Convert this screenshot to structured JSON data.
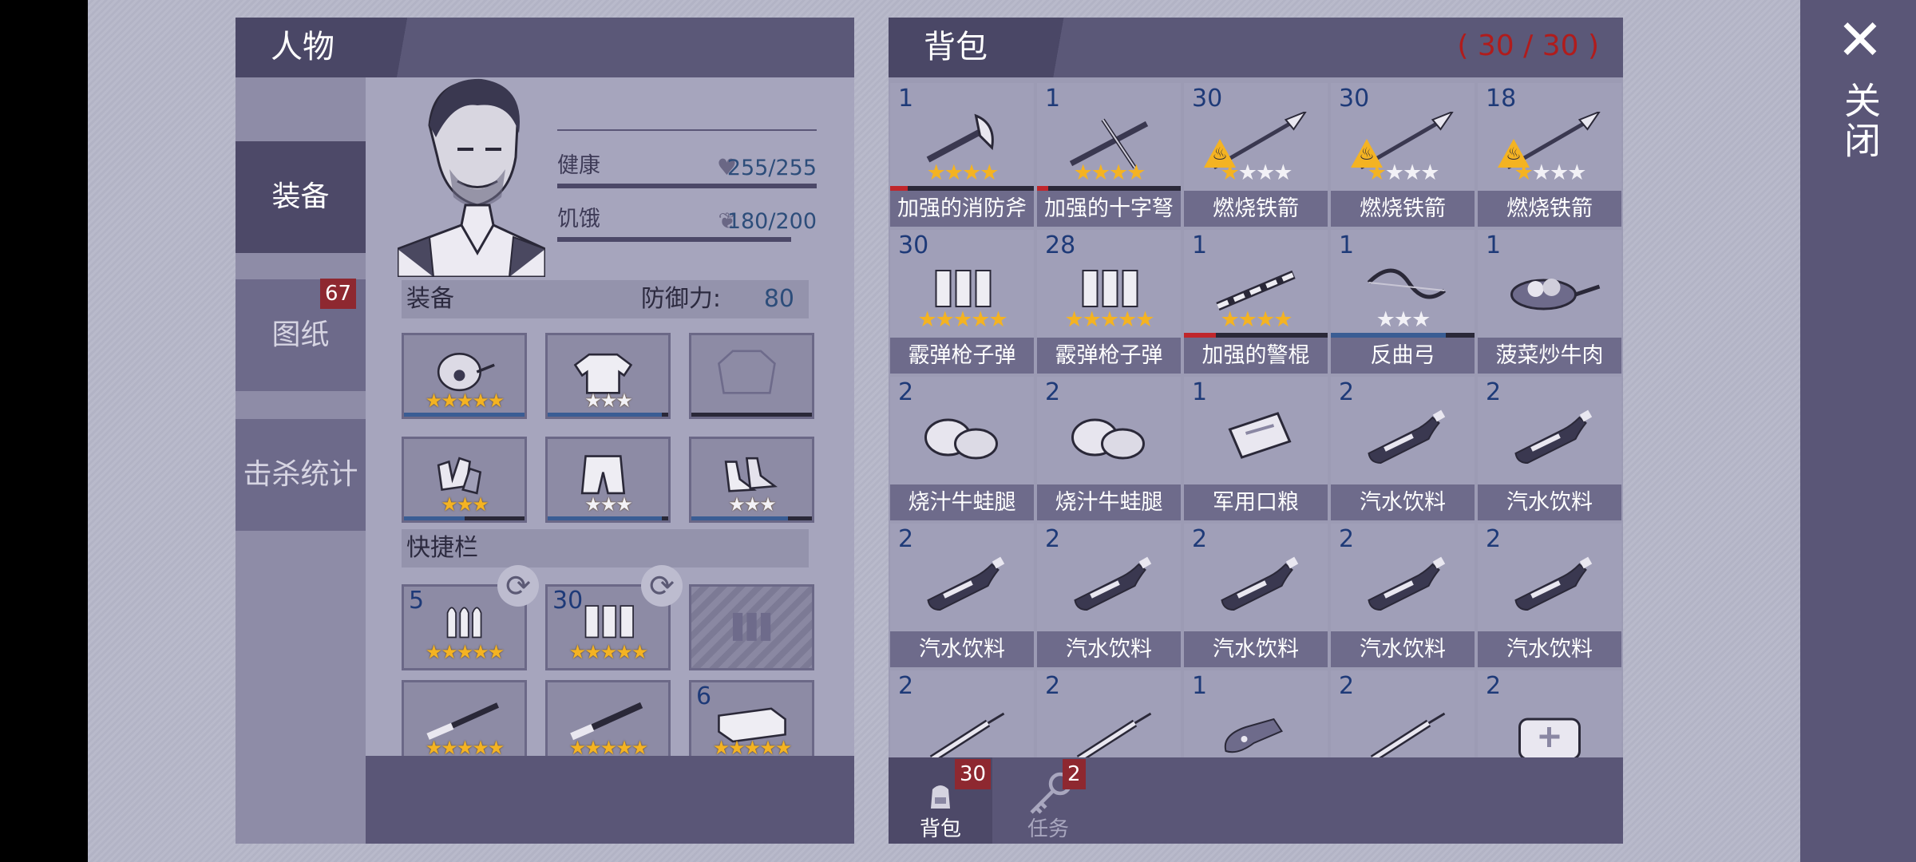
{
  "character": {
    "title": "人物",
    "tabs": [
      {
        "label": "装备",
        "active": true
      },
      {
        "label": "图纸",
        "badge": "67"
      },
      {
        "label": "击杀统计"
      }
    ],
    "stats": {
      "health_label": "健康",
      "health_value": "255/255",
      "health_fraction": 1.0,
      "hunger_label": "饥饿",
      "hunger_value": "180/200",
      "hunger_fraction": 0.9
    },
    "equipment": {
      "label": "装备",
      "defense_label": "防御力:",
      "defense_value": "80",
      "slots": [
        {
          "icon": "gas-mask-icon",
          "stars": 5,
          "filled": 5,
          "durability": 1.0
        },
        {
          "icon": "hoodie-icon",
          "stars": 3,
          "filled": 0,
          "durability": 0.95
        },
        {
          "icon": "jacket-slot-empty-icon",
          "stars": 0,
          "filled": 0,
          "durability": 0
        },
        {
          "icon": "gloves-icon",
          "stars": 3,
          "filled": 3,
          "durability": 0.5
        },
        {
          "icon": "shorts-icon",
          "stars": 3,
          "filled": 0,
          "durability": 0.95
        },
        {
          "icon": "shoes-icon",
          "stars": 3,
          "filled": 0,
          "durability": 0.8
        }
      ]
    },
    "quickbar": {
      "label": "快捷栏",
      "slots": [
        {
          "icon": "bullets-icon",
          "count": "5",
          "stars": 5,
          "filled": 5
        },
        {
          "icon": "shotgun-shells-icon",
          "count": "30",
          "stars": 5,
          "filled": 5
        },
        {
          "icon": "ammo-slot-empty-icon",
          "count": "",
          "stars": 0,
          "filled": 0
        },
        {
          "icon": "rifle-icon",
          "count": "",
          "stars": 5,
          "filled": 5,
          "durability": 1.0
        },
        {
          "icon": "shotgun-icon",
          "count": "",
          "stars": 5,
          "filled": 5,
          "durability": 1.0
        },
        {
          "icon": "brick-icon",
          "count": "6",
          "stars": 5,
          "filled": 5
        }
      ]
    }
  },
  "bag": {
    "title": "背包",
    "count": "( 30 / 30 )",
    "items": [
      {
        "count": "1",
        "name": "加强的消防斧",
        "icon": "axe-icon",
        "stars": 4,
        "filled": 4,
        "durability": 0.12,
        "dur_color": "#c0262b",
        "fire": false
      },
      {
        "count": "1",
        "name": "加强的十字弩",
        "icon": "crossbow-icon",
        "stars": 4,
        "filled": 4,
        "durability": 0.08,
        "dur_color": "#c0262b",
        "fire": false
      },
      {
        "count": "30",
        "name": "燃烧铁箭",
        "icon": "spear-arrow-icon",
        "stars": 4,
        "filled": 1,
        "durability": null,
        "fire": true
      },
      {
        "count": "30",
        "name": "燃烧铁箭",
        "icon": "spear-arrow-icon",
        "stars": 4,
        "filled": 1,
        "durability": null,
        "fire": true
      },
      {
        "count": "18",
        "name": "燃烧铁箭",
        "icon": "spear-arrow-icon",
        "stars": 4,
        "filled": 1,
        "durability": null,
        "fire": true
      },
      {
        "count": "30",
        "name": "霰弹枪子弹",
        "icon": "shotgun-shells-icon",
        "stars": 5,
        "filled": 5,
        "durability": null,
        "fire": false
      },
      {
        "count": "28",
        "name": "霰弹枪子弹",
        "icon": "shotgun-shells-icon",
        "stars": 5,
        "filled": 5,
        "durability": null,
        "fire": false
      },
      {
        "count": "1",
        "name": "加强的警棍",
        "icon": "baton-icon",
        "stars": 4,
        "filled": 4,
        "durability": 0.22,
        "dur_color": "#c0262b",
        "fire": false
      },
      {
        "count": "1",
        "name": "反曲弓",
        "icon": "recurve-bow-icon",
        "stars": 3,
        "filled": 0,
        "durability": 0.8,
        "dur_color": "#3a5d94",
        "fire": false
      },
      {
        "count": "1",
        "name": "菠菜炒牛肉",
        "icon": "stir-fry-pan-icon",
        "stars": 0,
        "filled": 0,
        "durability": null,
        "fire": false
      },
      {
        "count": "2",
        "name": "烧汁牛蛙腿",
        "icon": "frog-legs-icon",
        "stars": 0,
        "filled": 0,
        "durability": null,
        "fire": false
      },
      {
        "count": "2",
        "name": "烧汁牛蛙腿",
        "icon": "frog-legs-icon",
        "stars": 0,
        "filled": 0,
        "durability": null,
        "fire": false
      },
      {
        "count": "1",
        "name": "军用口粮",
        "icon": "ration-pack-icon",
        "stars": 0,
        "filled": 0,
        "durability": null,
        "fire": false
      },
      {
        "count": "2",
        "name": "汽水饮料",
        "icon": "soda-bottle-icon",
        "stars": 0,
        "filled": 0,
        "durability": null,
        "fire": false
      },
      {
        "count": "2",
        "name": "汽水饮料",
        "icon": "soda-bottle-icon",
        "stars": 0,
        "filled": 0,
        "durability": null,
        "fire": false
      },
      {
        "count": "2",
        "name": "汽水饮料",
        "icon": "soda-bottle-icon",
        "stars": 0,
        "filled": 0,
        "durability": null,
        "fire": false
      },
      {
        "count": "2",
        "name": "汽水饮料",
        "icon": "soda-bottle-icon",
        "stars": 0,
        "filled": 0,
        "durability": null,
        "fire": false
      },
      {
        "count": "2",
        "name": "汽水饮料",
        "icon": "soda-bottle-icon",
        "stars": 0,
        "filled": 0,
        "durability": null,
        "fire": false
      },
      {
        "count": "2",
        "name": "汽水饮料",
        "icon": "soda-bottle-icon",
        "stars": 0,
        "filled": 0,
        "durability": null,
        "fire": false
      },
      {
        "count": "2",
        "name": "汽水饮料",
        "icon": "soda-bottle-icon",
        "stars": 0,
        "filled": 0,
        "durability": null,
        "fire": false
      },
      {
        "count": "2",
        "name": "",
        "icon": "syringe-icon",
        "stars": 0,
        "filled": 0,
        "durability": null,
        "fire": false
      },
      {
        "count": "2",
        "name": "",
        "icon": "syringe-icon",
        "stars": 0,
        "filled": 0,
        "durability": null,
        "fire": false
      },
      {
        "count": "1",
        "name": "",
        "icon": "beer-bottle-icon",
        "stars": 0,
        "filled": 0,
        "durability": null,
        "fire": false
      },
      {
        "count": "2",
        "name": "",
        "icon": "syringe-icon",
        "stars": 0,
        "filled": 0,
        "durability": null,
        "fire": false
      },
      {
        "count": "2",
        "name": "",
        "icon": "first-aid-kit-icon",
        "stars": 0,
        "filled": 0,
        "durability": null,
        "fire": false
      }
    ],
    "footer_tabs": [
      {
        "label": "背包",
        "badge": "30",
        "icon": "backpack-icon",
        "active": true
      },
      {
        "label": "任务",
        "badge": "2",
        "icon": "key-icon",
        "active": false
      }
    ]
  },
  "close": {
    "label": "关闭",
    "icon": "close-icon"
  },
  "colors": {
    "accent": "#5a5677",
    "star": "#f4b322",
    "count": "#1e3a78",
    "alert": "#b01c1c"
  }
}
